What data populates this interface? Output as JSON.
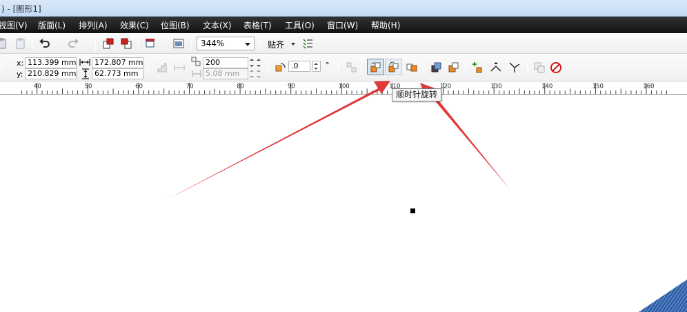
{
  "window": {
    "title": ") - [图形1]"
  },
  "menu": [
    "视图(V)",
    "版面(L)",
    "排列(A)",
    "效果(C)",
    "位图(B)",
    "文本(X)",
    "表格(T)",
    "工具(O)",
    "窗口(W)",
    "帮助(H)"
  ],
  "toolbar": {
    "zoom": "344%",
    "snap_label": "贴齐",
    "icons": [
      "paste-icon",
      "clipboard-icon",
      "undo-icon",
      "redo-icon",
      "import-icon",
      "export-icon",
      "publish-pdf-icon",
      "app-launcher-icon",
      "snap-settings-icon"
    ]
  },
  "property_bar": {
    "x_label": "x:",
    "x_value": "113.399 mm",
    "y_label": "y:",
    "y_value": "210.829 mm",
    "width_value": "172.807 mm",
    "height_value": "62.773 mm",
    "count_value": "200",
    "spacing_value": "5.08 mm",
    "angle_value": ".0",
    "angle_unit": "°"
  },
  "ruler": {
    "labels": [
      "40",
      "50",
      "60",
      "70",
      "80",
      "90",
      "100",
      "110",
      "120",
      "130",
      "140",
      "150",
      "160"
    ]
  },
  "tooltip": {
    "text": "顺时针旋转"
  },
  "colors": {
    "menubar": "#1a1a1a",
    "titlebar": "#c4daf3",
    "annotation_arrow": "#e03a3a",
    "tool_accent": "#e8862a"
  }
}
